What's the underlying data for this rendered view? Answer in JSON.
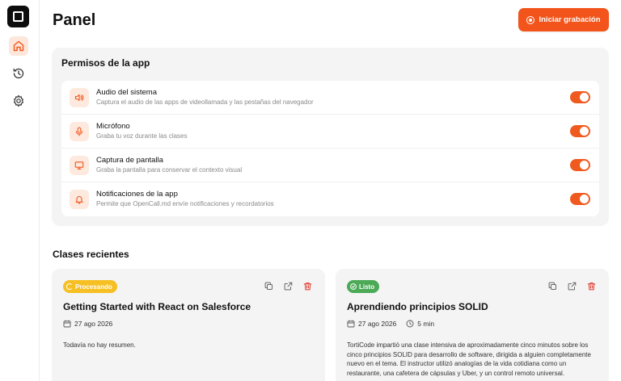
{
  "header": {
    "title": "Panel",
    "record_label": "Iniciar grabación"
  },
  "permissions": {
    "title": "Permisos de la app",
    "items": [
      {
        "name": "Audio del sistema",
        "description": "Captura el audio de las apps de videollamada y las pestañas del navegador",
        "icon": "speaker-icon",
        "enabled": true
      },
      {
        "name": "Micrófono",
        "description": "Graba tu voz durante las clases",
        "icon": "microphone-icon",
        "enabled": true
      },
      {
        "name": "Captura de pantalla",
        "description": "Graba la pantalla para conservar el contexto visual",
        "icon": "monitor-icon",
        "enabled": true
      },
      {
        "name": "Notificaciones de la app",
        "description": "Permite que OpenCall.md envíe notificaciones y recordatorios",
        "icon": "bell-icon",
        "enabled": true
      }
    ]
  },
  "recent": {
    "title": "Clases recientes",
    "classes": [
      {
        "status": "Procesando",
        "title": "Getting Started with React on Salesforce",
        "date": "27 ago 2026",
        "summary": "Todavía no hay resumen."
      },
      {
        "status": "Listo",
        "title": "Aprendiendo principios SOLID",
        "date": "27 ago 2026",
        "duration": "5 min",
        "summary": "TortiCode impartió una clase intensiva de aproximadamente cinco minutos sobre los cinco principios SOLID para desarrollo de software, dirigida a alguien completamente nuevo en el tema. El instructor utilizó analogías de la vida cotidiana como un restaurante, una cafetera de cápsulas y Uber, y un control remoto universal."
      }
    ]
  },
  "colors": {
    "accent": "#f2541b",
    "processing": "#f6c024",
    "done": "#4caa57",
    "delete": "#e0463a"
  }
}
